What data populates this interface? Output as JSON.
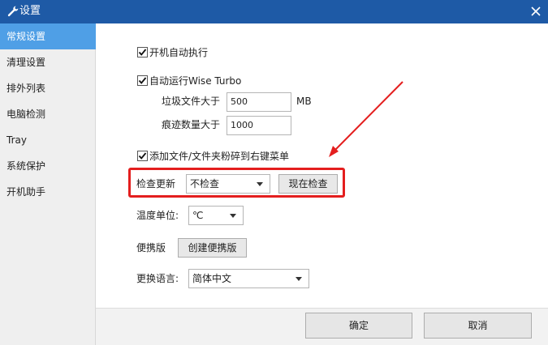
{
  "window": {
    "title": "设置",
    "title_icon": "wrench-icon",
    "close_icon": "close-icon"
  },
  "sidebar": {
    "items": [
      {
        "label": "常规设置",
        "active": true
      },
      {
        "label": "清理设置"
      },
      {
        "label": "排外列表"
      },
      {
        "label": "电脑检测"
      },
      {
        "label": "Tray"
      },
      {
        "label": "系统保护"
      },
      {
        "label": "开机助手"
      }
    ]
  },
  "general": {
    "startup": {
      "label": "开机自动执行",
      "checked": true
    },
    "wise_turbo": {
      "label": "自动运行Wise Turbo",
      "checked": true
    },
    "junk_size": {
      "label": "垃圾文件大于",
      "value": "500",
      "unit": "MB"
    },
    "trace_count": {
      "label": "痕迹数量大于",
      "value": "1000"
    },
    "context_menu": {
      "label": "添加文件/文件夹粉碎到右键菜单",
      "checked": true
    },
    "update": {
      "label": "检查更新",
      "selected": "不检查",
      "check_now_label": "现在检查"
    },
    "temperature": {
      "label": "温度单位:",
      "selected": "℃"
    },
    "portable": {
      "label": "便携版",
      "button_label": "创建便携版"
    },
    "language": {
      "label": "更换语言:",
      "selected": "简体中文"
    }
  },
  "footer": {
    "ok_label": "确定",
    "cancel_label": "取消"
  },
  "annotation": {
    "highlight_color": "#e41e1e"
  },
  "colors": {
    "titlebar": "#1e5aa6",
    "active_nav": "#4f9fe6"
  }
}
